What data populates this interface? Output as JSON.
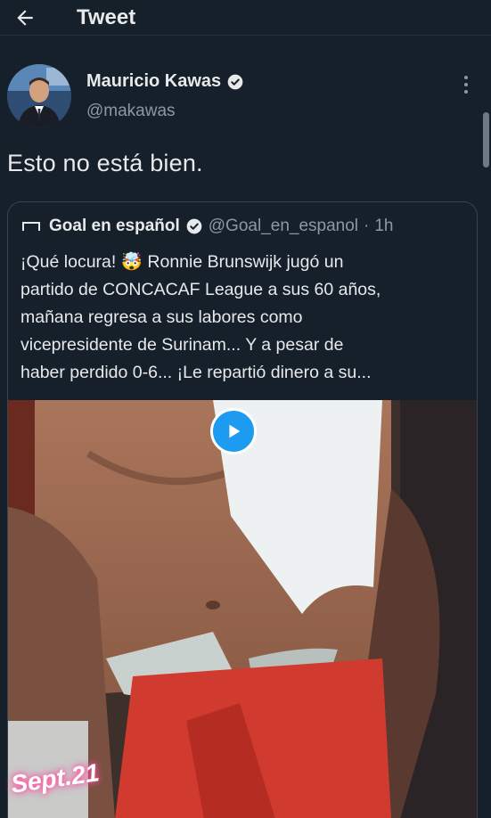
{
  "header": {
    "title": "Tweet",
    "back_icon": "arrow-left-icon"
  },
  "author": {
    "name": "Mauricio Kawas",
    "handle": "@makawas",
    "verified": true
  },
  "tweet": {
    "text": "Esto no está bien."
  },
  "quoted_tweet": {
    "name": "Goal en español",
    "handle": "@Goal_en_espanol",
    "separator": "·",
    "time": "1h",
    "verified": true,
    "lines": [
      "¡Qué locura! 🤯 Ronnie Brunswijk jugó un",
      "partido de CONCACAF League a sus 60 años,",
      "mañana regresa a sus labores como",
      "vicepresidente de Surinam... Y a pesar de",
      "haber perdido 0-6... ¡Le repartió dinero a su..."
    ],
    "media": {
      "type": "video",
      "caption": "Sept.21",
      "play_icon": "play-icon"
    }
  },
  "colors": {
    "background": "#15202b",
    "text_primary": "#e7e9ea",
    "text_secondary": "#8b98a5",
    "accent": "#1d9bf0",
    "border": "#38444d"
  }
}
